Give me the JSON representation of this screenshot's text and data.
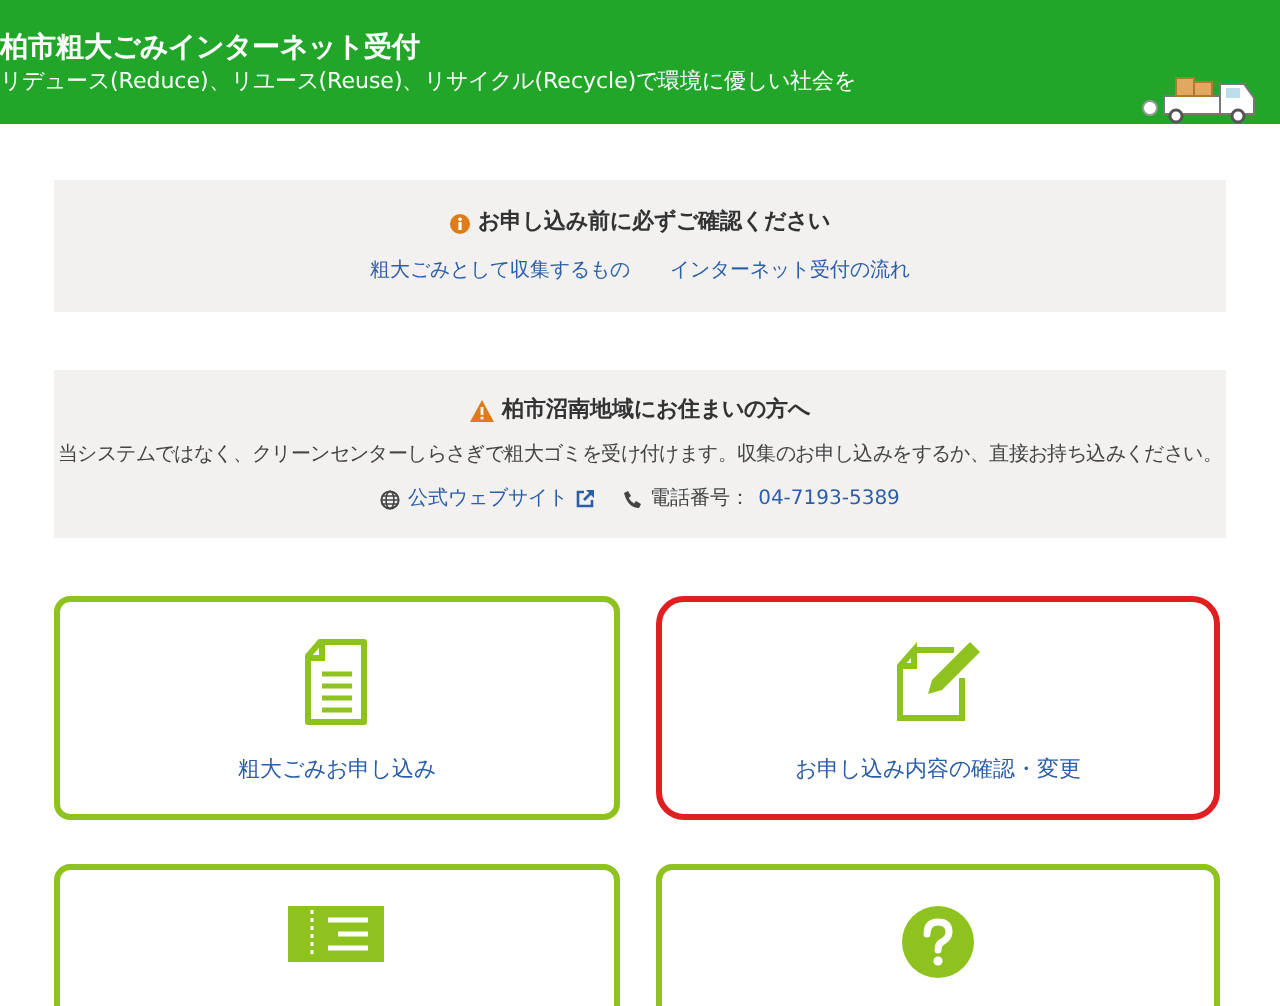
{
  "header": {
    "title": "柏市粗大ごみインターネット受付",
    "subtitle": "リデュース(Reduce)、リユース(Reuse)、リサイクル(Recycle)で環境に優しい社会を"
  },
  "notice": {
    "heading": "お申し込み前に必ずご確認ください",
    "links": [
      "粗大ごみとして収集するもの",
      "インターネット受付の流れ"
    ]
  },
  "area_notice": {
    "heading": "柏市沼南地域にお住まいの方へ",
    "body": "当システムではなく、クリーンセンターしらさぎで粗大ゴミを受け付けます。収集のお申し込みをするか、直接お持ち込みください。",
    "website_link": "公式ウェブサイト",
    "phone_label": "電話番号：",
    "phone_number": "04-7193-5389"
  },
  "cards": [
    {
      "kind": "document",
      "label": "粗大ごみお申し込み",
      "highlighted": false
    },
    {
      "kind": "edit",
      "label": "お申し込み内容の確認・変更",
      "highlighted": true
    },
    {
      "kind": "ticket",
      "highlighted": false
    },
    {
      "kind": "help",
      "highlighted": false
    }
  ]
}
